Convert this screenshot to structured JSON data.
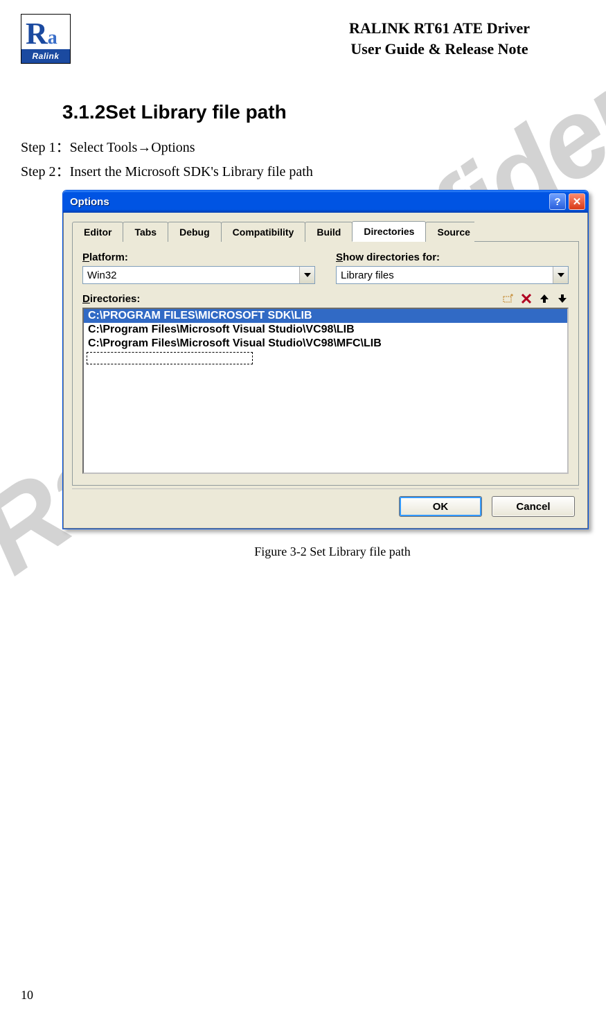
{
  "watermark_text": "Ralink Confidential",
  "logo_brand": "Ralink",
  "header": {
    "line1": "RALINK RT61 ATE Driver",
    "line2": "User Guide & Release Note"
  },
  "section": {
    "number": "3.1.2",
    "title": "Set Library file path"
  },
  "steps": {
    "step1_prefix": "Step 1",
    "step1_text": "Select Tools",
    "step1_arrow": "→",
    "step1_after": "Options",
    "step2_prefix": "Step 2",
    "step2_text": "Insert the Microsoft SDK's Library file path"
  },
  "dialog": {
    "title": "Options",
    "help_label": "?",
    "close_label": "✕",
    "tabs": [
      "Editor",
      "Tabs",
      "Debug",
      "Compatibility",
      "Build",
      "Directories",
      "Source"
    ],
    "active_tab_index": 5,
    "platform_label": "Platform:",
    "platform_value": "Win32",
    "showfor_label": "Show directories for:",
    "showfor_value": "Library files",
    "directories_label": "Directories:",
    "toolbar_icons": [
      "new-folder-icon",
      "delete-icon",
      "move-up-icon",
      "move-down-icon"
    ],
    "list": [
      "C:\\PROGRAM FILES\\MICROSOFT SDK\\LIB",
      "C:\\Program Files\\Microsoft Visual Studio\\VC98\\LIB",
      "C:\\Program Files\\Microsoft Visual Studio\\VC98\\MFC\\LIB"
    ],
    "selected_index": 0,
    "ok_label": "OK",
    "cancel_label": "Cancel"
  },
  "figure_caption": "Figure 3-2 Set Library file path",
  "page_number": "10"
}
